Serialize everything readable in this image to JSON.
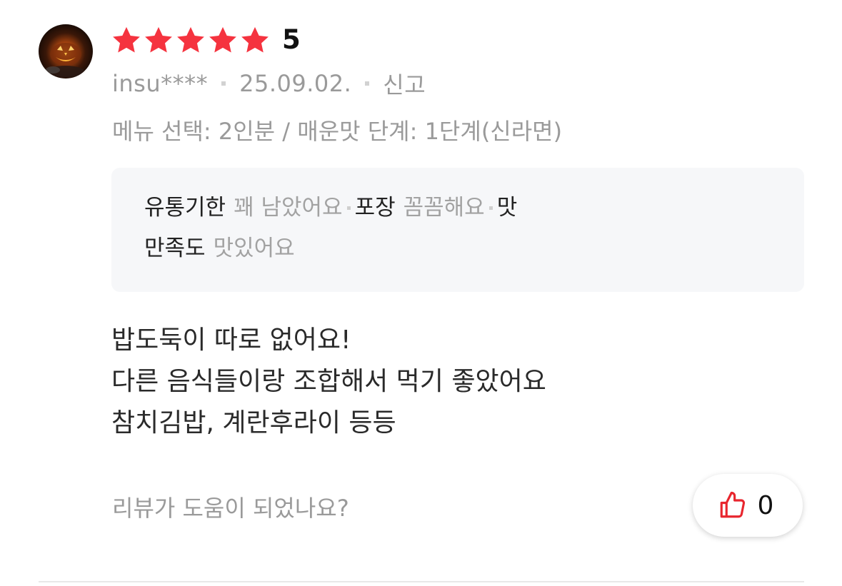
{
  "review": {
    "rating_value": "5",
    "stars_filled": 5,
    "star_color": "#f5333f",
    "username": "insu****",
    "date": "25.09.02.",
    "report_label": "신고",
    "menu_selection": "메뉴 선택: 2인분 / 매운맛 단계: 1단계(신라면)",
    "tags": [
      {
        "key": "유통기한",
        "value": "꽤 남았어요"
      },
      {
        "key": "포장",
        "value": "꼼꼼해요"
      },
      {
        "key": "맛",
        "value": ""
      },
      {
        "key": "만족도",
        "value": "맛있어요"
      }
    ],
    "body_lines": [
      "밥도둑이 따로 없어요!",
      "다른 음식들이랑 조합해서 먹기 좋았어요",
      "참치김밥, 계란후라이 등등"
    ],
    "helpful_question": "리뷰가 도움이 되었나요?",
    "like_count": "0",
    "like_icon_color": "#e8262e"
  }
}
